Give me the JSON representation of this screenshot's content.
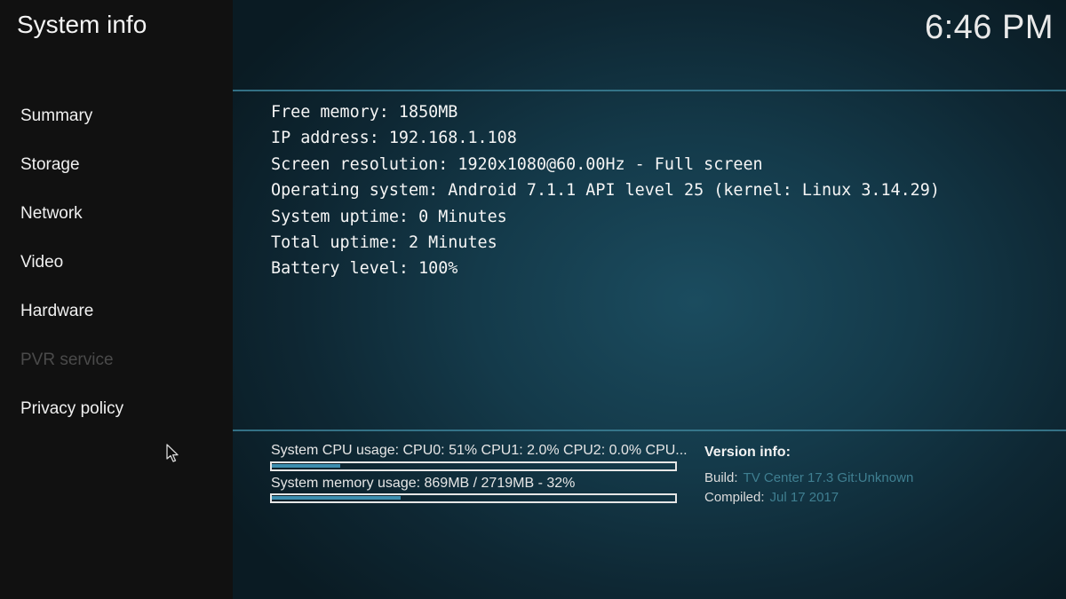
{
  "header": {
    "title": "System info",
    "clock": "6:46 PM"
  },
  "sidebar": {
    "items": [
      {
        "label": "Summary",
        "enabled": true
      },
      {
        "label": "Storage",
        "enabled": true
      },
      {
        "label": "Network",
        "enabled": true
      },
      {
        "label": "Video",
        "enabled": true
      },
      {
        "label": "Hardware",
        "enabled": true
      },
      {
        "label": "PVR service",
        "enabled": false
      },
      {
        "label": "Privacy policy",
        "enabled": true
      }
    ]
  },
  "summary": {
    "lines": [
      "Free memory: 1850MB",
      "IP address: 192.168.1.108",
      "Screen resolution: 1920x1080@60.00Hz - Full screen",
      "Operating system: Android 7.1.1 API level 25 (kernel: Linux 3.14.29)",
      "System uptime: 0 Minutes",
      "Total uptime: 2 Minutes",
      "Battery level: 100%"
    ]
  },
  "usage": {
    "cpu": {
      "label": "System CPU usage: CPU0:  51% CPU1: 2.0% CPU2: 0.0% CPU...",
      "fraction": 0.17
    },
    "memory": {
      "label": "System memory usage: 869MB / 2719MB - 32%",
      "fraction": 0.32
    }
  },
  "version": {
    "title": "Version info:",
    "build_label": "Build:",
    "build_value": "TV Center 17.3 Git:Unknown",
    "compiled_label": "Compiled:",
    "compiled_value": "Jul 17 2017"
  },
  "colors": {
    "accent": "#3e8fb0",
    "divider": "#3b7f95",
    "disabled_text": "#4a4a4a",
    "value_text": "#3f7f91"
  },
  "icons": {
    "cursor": "mouse-pointer-icon"
  }
}
